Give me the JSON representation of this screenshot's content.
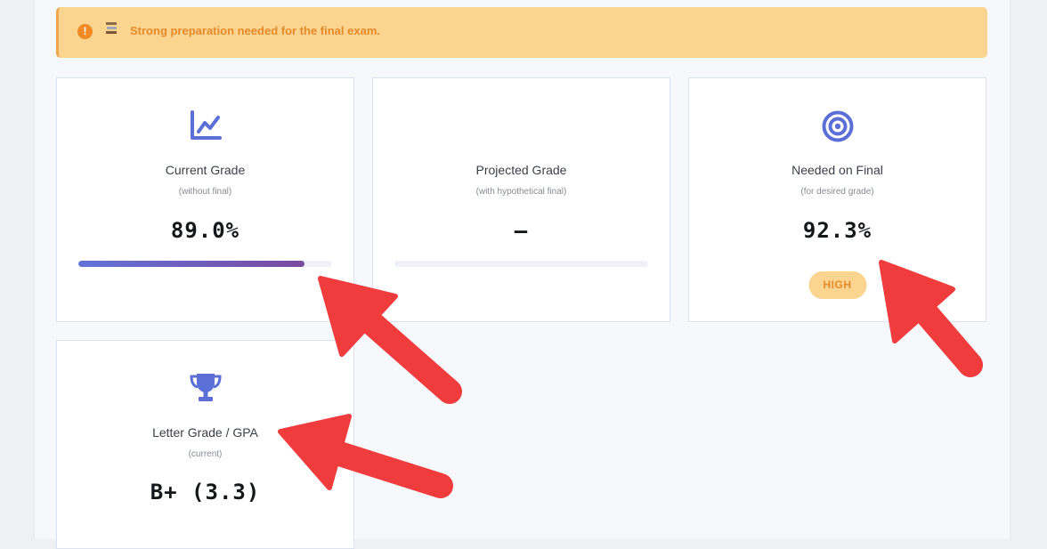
{
  "alert": {
    "message": "Strong preparation needed for the final exam.",
    "icon": "warning-icon",
    "secondary_icon": "books-icon"
  },
  "cards": {
    "current": {
      "icon": "line-chart-icon",
      "title": "Current Grade",
      "subtitle": "(without final)",
      "value": "89.0%",
      "progress": 0.89
    },
    "projected": {
      "title": "Projected Grade",
      "subtitle": "(with hypothetical final)",
      "value": "–",
      "progress": 0
    },
    "needed": {
      "icon": "target-icon",
      "title": "Needed on Final",
      "subtitle": "(for desired grade)",
      "value": "92.3%",
      "badge": "HIGH"
    },
    "letter": {
      "icon": "trophy-icon",
      "title": "Letter Grade / GPA",
      "subtitle": "(current)",
      "value": "B+ (3.3)"
    }
  },
  "colors": {
    "accent": "#5b6fd6",
    "alert_bg": "#fbd48f",
    "alert_text": "#e58a2b",
    "annotation_arrow": "#f03c3c"
  }
}
